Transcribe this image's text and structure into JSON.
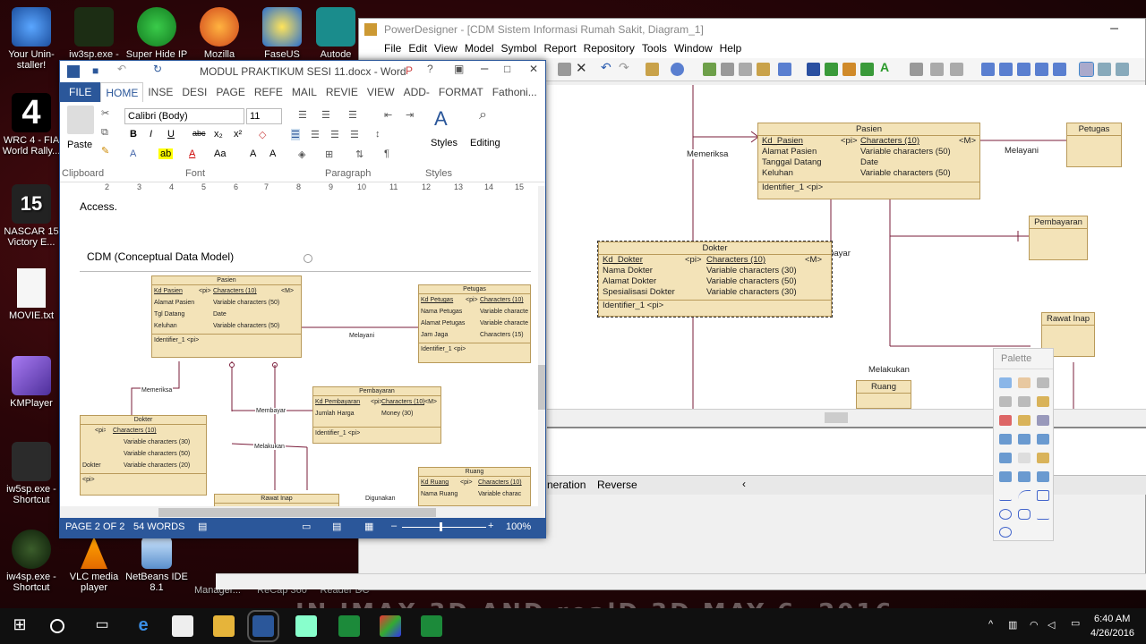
{
  "desktop": {
    "icons": [
      {
        "label": "Your Unin-staller!"
      },
      {
        "label": "iw3sp.exe -"
      },
      {
        "label": "Super Hide IP"
      },
      {
        "label": "Mozilla"
      },
      {
        "label": "FaseUS"
      },
      {
        "label": "Autode"
      },
      {
        "label": "WRC 4 - FIA World Rally..."
      },
      {
        "label": "NASCAR 15 Victory E..."
      },
      {
        "label": "MOVIE.txt"
      },
      {
        "label": "KMPlayer"
      },
      {
        "label": "iw5sp.exe - Shortcut"
      },
      {
        "label": "iw4sp.exe - Shortcut"
      },
      {
        "label": "VLC media player"
      },
      {
        "label": "NetBeans IDE 8.1"
      },
      {
        "label": "Manager..."
      },
      {
        "label": "ReCap 360"
      },
      {
        "label": "Reader DC"
      }
    ],
    "watermark": "IN IMAX 3D AND realD 3D MAY 6, 2016"
  },
  "pd": {
    "title": "PowerDesigner - [CDM Sistem Informasi Rumah Sakit, Diagram_1]",
    "menu": [
      "File",
      "Edit",
      "View",
      "Model",
      "Symbol",
      "Report",
      "Repository",
      "Tools",
      "Window",
      "Help"
    ],
    "tabs": [
      "neration",
      "Reverse"
    ],
    "palette_title": "Palette",
    "entities": {
      "pasien": {
        "name": "Pasien",
        "rows": [
          [
            "Kd_Pasien",
            "<pi>",
            "Characters (10)",
            "<M>"
          ],
          [
            "Alamat Pasien",
            "",
            "Variable characters (50)",
            ""
          ],
          [
            "Tanggal Datang",
            "",
            "Date",
            ""
          ],
          [
            "Keluhan",
            "",
            "Variable characters (50)",
            ""
          ]
        ],
        "id": "Identifier_1 <pi>"
      },
      "dokter": {
        "name": "Dokter",
        "rows": [
          [
            "Kd_Dokter",
            "<pi>",
            "Characters (10)",
            "<M>"
          ],
          [
            "Nama Dokter",
            "",
            "Variable characters (30)",
            ""
          ],
          [
            "Alamat Dokter",
            "",
            "Variable characters (50)",
            ""
          ],
          [
            "Spesialisasi Dokter",
            "",
            "Variable characters (30)",
            ""
          ]
        ],
        "id": "Identifier_1 <pi>"
      },
      "petugas": "Petugas",
      "pembayaran": "Pembayaran",
      "rawat_inap": "Rawat Inap",
      "ruang": "Ruang"
    },
    "labels": {
      "memeriksa": "Memeriksa",
      "melayani": "Melayani",
      "membayar": "Membayar",
      "melakukan": "Melakukan"
    }
  },
  "word": {
    "title": "MODUL PRAKTIKUM SESI 11.docx - Word",
    "tabs": [
      "FILE",
      "HOME",
      "INSE",
      "DESI",
      "PAGE",
      "REFE",
      "MAIL",
      "REVIE",
      "VIEW",
      "ADD-",
      "FORMAT",
      "Fathoni..."
    ],
    "ribbon": {
      "paste": "Paste",
      "font": "Calibri (Body)",
      "size": "11",
      "styles": "Styles",
      "editing": "Editing",
      "g_clipboard": "Clipboard",
      "g_font": "Font",
      "g_paragraph": "Paragraph",
      "g_styles": "Styles"
    },
    "ruler": [
      "2",
      "3",
      "4",
      "5",
      "6",
      "7",
      "8",
      "9",
      "10",
      "11",
      "12",
      "13",
      "14",
      "15"
    ],
    "doc": {
      "access": "Access.",
      "heading": "CDM (Conceptual Data Model)",
      "pasien": {
        "name": "Pasien",
        "rows": [
          [
            "Kd Pasien",
            "<pi>",
            "Characters (10)",
            "<M>"
          ],
          [
            "Alamat Pasien",
            "",
            "Variable characters (50)",
            ""
          ],
          [
            "Tgl Datang",
            "",
            "Date",
            ""
          ],
          [
            "Keluhan",
            "",
            "Variable characters (50)",
            ""
          ]
        ],
        "id": "Identifier_1 <pi>"
      },
      "petugas": {
        "name": "Petugas",
        "rows": [
          [
            "Kd Petugas",
            "<pi>",
            "Characters (10)"
          ],
          [
            "Nama Petugas",
            "",
            "Variable characte"
          ],
          [
            "Alamat Petugas",
            "",
            "Variable characte"
          ],
          [
            "Jam Jaga",
            "",
            "Characters (15)"
          ]
        ],
        "id": "Identifier_1 <pi>"
      },
      "pembayaran": {
        "name": "Pembayaran",
        "rows": [
          [
            "Kd Pembayaran",
            "<pi>",
            "Characters (10)",
            "<M>"
          ],
          [
            "Jumlah Harga",
            "",
            "Money (30)",
            ""
          ]
        ],
        "id": "Identifier_1 <pi>"
      },
      "dokter": {
        "name": "Dokter",
        "rows": [
          [
            "<pi>",
            "Characters (10)"
          ],
          [
            "",
            "Variable characters (30)"
          ],
          [
            "",
            "Variable characters (50)"
          ],
          [
            "Dokter",
            "Variable characters (20)"
          ]
        ],
        "id": "<pi>"
      },
      "ruang": {
        "name": "Ruang",
        "rows": [
          [
            "Kd Ruang",
            "<pi>",
            "Characters (10)"
          ],
          [
            "Nama Ruang",
            "",
            "Variable charac"
          ]
        ]
      },
      "rawat": "Rawat Inap",
      "labels": {
        "memeriksa": "Memeriksa",
        "melayani": "Melayani",
        "membayar": "Membayar",
        "melakukan": "Melakukan",
        "digunakan": "Digunakan"
      }
    },
    "status": {
      "page": "PAGE 2 OF 2",
      "words": "54 WORDS",
      "zoom": "100%"
    }
  },
  "taskbar": {
    "time": "6:40 AM",
    "date": "4/26/2016"
  }
}
